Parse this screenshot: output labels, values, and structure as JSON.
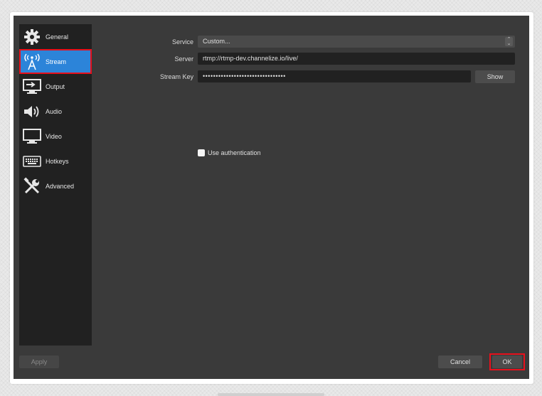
{
  "sidebar": {
    "items": [
      {
        "label": "General",
        "icon": "gear-icon"
      },
      {
        "label": "Stream",
        "icon": "antenna-icon"
      },
      {
        "label": "Output",
        "icon": "output-icon"
      },
      {
        "label": "Audio",
        "icon": "speaker-icon"
      },
      {
        "label": "Video",
        "icon": "monitor-icon"
      },
      {
        "label": "Hotkeys",
        "icon": "keyboard-icon"
      },
      {
        "label": "Advanced",
        "icon": "tools-icon"
      }
    ],
    "active": "Stream"
  },
  "stream": {
    "service_label": "Service",
    "service_value": "Custom...",
    "server_label": "Server",
    "server_value": "rtmp://rtmp-dev.channelize.io/live/",
    "key_label": "Stream Key",
    "key_value": "••••••••••••••••••••••••••••••••",
    "show_label": "Show",
    "auth_label": "Use authentication"
  },
  "footer": {
    "apply_label": "Apply",
    "cancel_label": "Cancel",
    "ok_label": "OK"
  },
  "colors": {
    "window_bg": "#3a3a3a",
    "sidebar_bg": "#212121",
    "accent": "#2c84d9",
    "highlight_outline": "#e8101c"
  }
}
